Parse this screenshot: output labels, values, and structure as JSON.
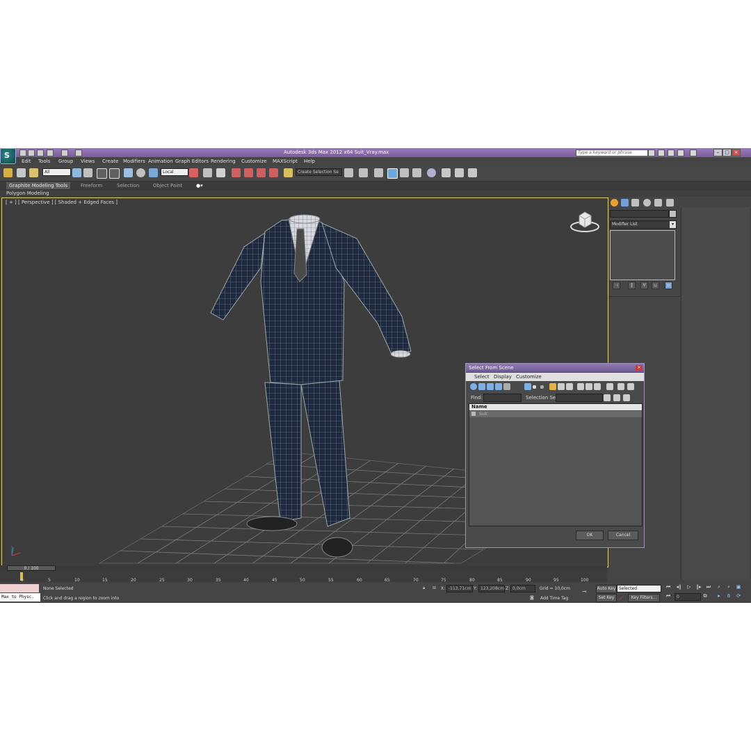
{
  "app": {
    "title": "Autodesk 3ds Max  2012 x64     Suit_Vray.max",
    "search_placeholder": "Type a keyword or phrase"
  },
  "menu": [
    "Edit",
    "Tools",
    "Group",
    "Views",
    "Create",
    "Modifiers",
    "Animation",
    "Graph Editors",
    "Rendering",
    "Customize",
    "MAXScript",
    "Help"
  ],
  "toolbar": {
    "filter": "All",
    "coord_system": "Local",
    "named_sel": "Create Selection Se"
  },
  "ribbon": {
    "tabs": [
      "Graphite Modeling Tools",
      "Freeform",
      "Selection",
      "Object Paint"
    ],
    "sub_label": "Polygon Modeling"
  },
  "viewport": {
    "label": "[ + ] [ Perspective ] [ Shaded + Edged Faces ]"
  },
  "command_panel": {
    "modifier_list": "Modifier List"
  },
  "dialog": {
    "title": "Select From Scene",
    "menu": [
      "Select",
      "Display",
      "Customize"
    ],
    "find_label": "Find:",
    "selection_set_label": "Selection Set:",
    "column_header": "Name",
    "rows": [
      "Suit"
    ],
    "ok": "OK",
    "cancel": "Cancel"
  },
  "timeline": {
    "frame_readout": "0 / 100",
    "ticks": [
      "0",
      "5",
      "10",
      "15",
      "20",
      "25",
      "30",
      "35",
      "40",
      "45",
      "50",
      "55",
      "60",
      "65",
      "70",
      "75",
      "80",
      "85",
      "90",
      "95",
      "100"
    ]
  },
  "status": {
    "maxscript": "Max to Physc.",
    "selection": "None Selected",
    "prompt": "Click and drag a region to zoom into",
    "x_label": "X:",
    "x": "-113,71cm",
    "y_label": "Y:",
    "y": "123,208cm",
    "z_label": "Z:",
    "z": "0,0cm",
    "grid": "Grid = 10,0cm",
    "add_time_tag": "Add Time Tag",
    "auto_key": "Auto Key",
    "set_key": "Set Key",
    "key_mode": "Selected",
    "key_filters": "Key Filters...",
    "frame": "0"
  }
}
